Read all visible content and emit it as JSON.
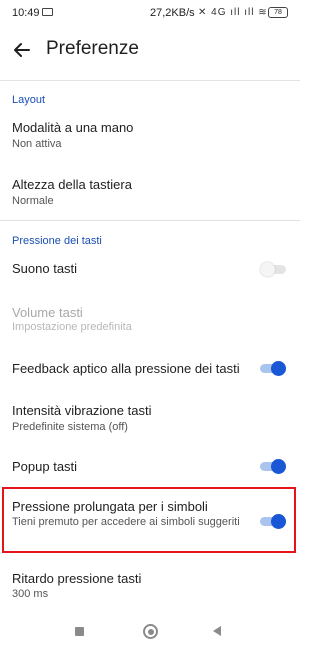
{
  "status_bar": {
    "time": "10:49",
    "speed": "27,2KB/s",
    "icons": "✕ 4G ıll ıll ≋",
    "battery": "78"
  },
  "app_bar": {
    "title": "Preferenze"
  },
  "sections": [
    {
      "header": "Layout",
      "items": [
        {
          "title": "Modalità a una mano",
          "summary": "Non attiva"
        },
        {
          "title": "Altezza della tastiera",
          "summary": "Normale"
        }
      ]
    },
    {
      "header": "Pressione dei tasti",
      "items": [
        {
          "title": "Suono tasti",
          "toggle": false
        },
        {
          "title": "Volume tasti",
          "summary": "Impostazione predefinita",
          "disabled": true
        },
        {
          "title": "Feedback aptico alla pressione dei tasti",
          "toggle": true
        },
        {
          "title": "Intensità vibrazione tasti",
          "summary": "Predefinite sistema (off)"
        },
        {
          "title": "Popup tasti",
          "toggle": true
        },
        {
          "title": "Pressione prolungata per i simboli",
          "summary": "Tieni premuto per accedere ai simboli suggeriti",
          "toggle": true,
          "highlighted": true
        },
        {
          "title": "Ritardo pressione tasti",
          "summary": "300 ms"
        }
      ]
    }
  ],
  "colors": {
    "accent": "#1a57d6",
    "section_header": "#1a4fb5",
    "highlight": "#e3141c"
  },
  "nav_bar": {
    "icons": [
      "recents-icon",
      "home-icon",
      "back-icon"
    ]
  }
}
